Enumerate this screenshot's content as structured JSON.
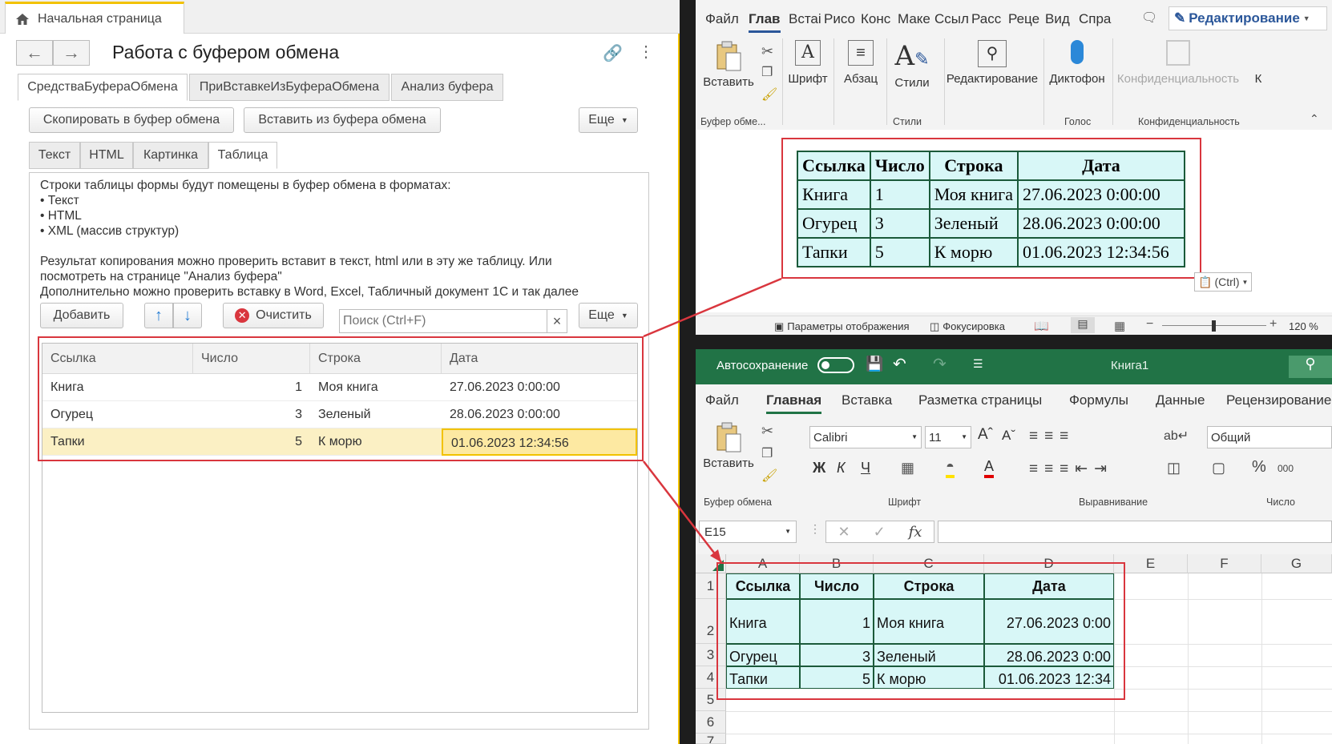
{
  "onec": {
    "home_tab": "Начальная страница",
    "title": "Работа с буфером обмена",
    "main_tabs": [
      "СредстваБуфераОбмена",
      "ПриВставкеИзБуфераОбмена",
      "Анализ буфера"
    ],
    "copy_button": "Скопировать в буфер обмена",
    "paste_button": "Вставить из буфера обмена",
    "more_button": "Еще",
    "sub_tabs": [
      "Текст",
      "HTML",
      "Картинка",
      "Таблица"
    ],
    "description": "Строки таблицы формы будут помещены в буфер обмена в форматах:\n• Текст\n• HTML\n• XML (массив структур)\n\nРезультат копирования можно проверить вставит в текст, html или в эту же таблицу. Или\nпосмотреть на странице \"Анализ буфера\"\nДополнительно можно проверить вставку в Word, Excel, Табличный документ 1С и так далее",
    "add_button": "Добавить",
    "clear_button": "Очистить",
    "search_placeholder": "Поиск (Ctrl+F)",
    "more_button2": "Еще",
    "columns": [
      "Ссылка",
      "Число",
      "Строка",
      "Дата"
    ],
    "rows": [
      [
        "Книга",
        "1",
        "Моя книга",
        "27.06.2023 0:00:00"
      ],
      [
        "Огурец",
        "3",
        "Зеленый",
        "28.06.2023 0:00:00"
      ],
      [
        "Тапки",
        "5",
        "К морю",
        "01.06.2023 12:34:56"
      ]
    ]
  },
  "word": {
    "tabs": [
      "Файл",
      "Глав",
      "Встаі",
      "Рисо",
      "Конс",
      "Маке",
      "Ссыл",
      "Расс",
      "Реце",
      "Вид",
      "Спра"
    ],
    "edit_mode": "Редактирование",
    "ribbon": {
      "paste": "Вставить",
      "font": "Шрифт",
      "paragraph": "Абзац",
      "styles": "Стили",
      "editing": "Редактирование",
      "dictate": "Диктофон",
      "sensitivity": "Конфиденциальность",
      "k": "К"
    },
    "groups": {
      "clipboard": "Буфер обме...",
      "styles": "Стили",
      "voice": "Голос",
      "sensitivity": "Конфиденциальность"
    },
    "table": [
      [
        "Ссылка",
        "Число",
        "Строка",
        "Дата"
      ],
      [
        "Книга",
        "1",
        "Моя книга",
        "27.06.2023 0:00:00"
      ],
      [
        "Огурец",
        "3",
        "Зеленый",
        "28.06.2023 0:00:00"
      ],
      [
        "Тапки",
        "5",
        "К морю",
        "01.06.2023 12:34:56"
      ]
    ],
    "paste_options": "(Ctrl)",
    "status": {
      "display_settings": "Параметры отображения",
      "focus": "Фокусировка",
      "zoom": "120 %"
    }
  },
  "excel": {
    "autosave": "Автосохранение",
    "book_title": "Книга1",
    "tabs": [
      "Файл",
      "Главная",
      "Вставка",
      "Разметка страницы",
      "Формулы",
      "Данные",
      "Рецензирование"
    ],
    "paste": "Вставить",
    "font_name": "Calibri",
    "font_size": "11",
    "bold": "Ж",
    "italic": "К",
    "underline": "Ч",
    "number_format": "Общий",
    "groups": {
      "clipboard": "Буфер обмена",
      "font": "Шрифт",
      "alignment": "Выравнивание",
      "number": "Число"
    },
    "name_box": "E15",
    "col_headers": [
      "A",
      "B",
      "C",
      "D",
      "E",
      "F",
      "G"
    ],
    "row_headers": [
      "1",
      "2",
      "3",
      "4",
      "5",
      "6",
      "7"
    ],
    "cells": [
      [
        "Ссылка",
        "Число",
        "Строка",
        "Дата"
      ],
      [
        "Книга",
        "1",
        "Моя книга",
        "27.06.2023 0:00"
      ],
      [
        "Огурец",
        "3",
        "Зеленый",
        "28.06.2023 0:00"
      ],
      [
        "Тапки",
        "5",
        "К морю",
        "01.06.2023 12:34"
      ]
    ]
  },
  "colors": {
    "accent_1c": "#f2c200",
    "highlight_red": "#d9363e",
    "excel_green": "#217346",
    "table_fill": "#d8f7f7"
  }
}
